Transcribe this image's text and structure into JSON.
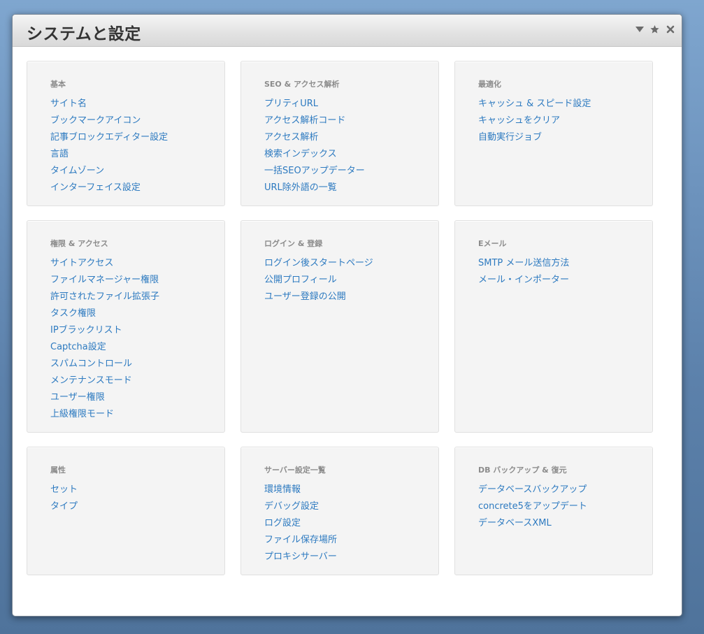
{
  "window": {
    "title": "システムと設定"
  },
  "controls": {
    "collapse_icon": "triangle-down-icon",
    "favorite_icon": "star-icon",
    "close_icon": "close-icon"
  },
  "sections": [
    {
      "title": "基本",
      "items": [
        "サイト名",
        "ブックマークアイコン",
        "記事ブロックエディター設定",
        "言語",
        "タイムゾーン",
        "インターフェイス設定"
      ]
    },
    {
      "title": "SEO & アクセス解析",
      "items": [
        "プリティURL",
        "アクセス解析コード",
        "アクセス解析",
        "検索インデックス",
        "一括SEOアップデーター",
        "URL除外語の一覧"
      ]
    },
    {
      "title": "最適化",
      "items": [
        "キャッシュ & スピード設定",
        "キャッシュをクリア",
        "自動実行ジョブ"
      ]
    },
    {
      "title": "権限 & アクセス",
      "items": [
        "サイトアクセス",
        "ファイルマネージャー権限",
        "許可されたファイル拡張子",
        "タスク権限",
        "IPブラックリスト",
        "Captcha設定",
        "スパムコントロール",
        "メンテナンスモード",
        "ユーザー権限",
        "上級権限モード"
      ]
    },
    {
      "title": "ログイン & 登録",
      "items": [
        "ログイン後スタートページ",
        "公開プロフィール",
        "ユーザー登録の公開"
      ]
    },
    {
      "title": "Eメール",
      "items": [
        "SMTP メール送信方法",
        "メール・インポーター"
      ]
    },
    {
      "title": "属性",
      "items": [
        "セット",
        "タイプ"
      ]
    },
    {
      "title": "サーバー設定一覧",
      "items": [
        "環境情報",
        "デバッグ設定",
        "ログ設定",
        "ファイル保存場所",
        "プロキシサーバー"
      ]
    },
    {
      "title": "DB バックアップ & 復元",
      "items": [
        "データベースバックアップ",
        "concrete5をアップデート",
        "データベースXML"
      ]
    }
  ]
}
